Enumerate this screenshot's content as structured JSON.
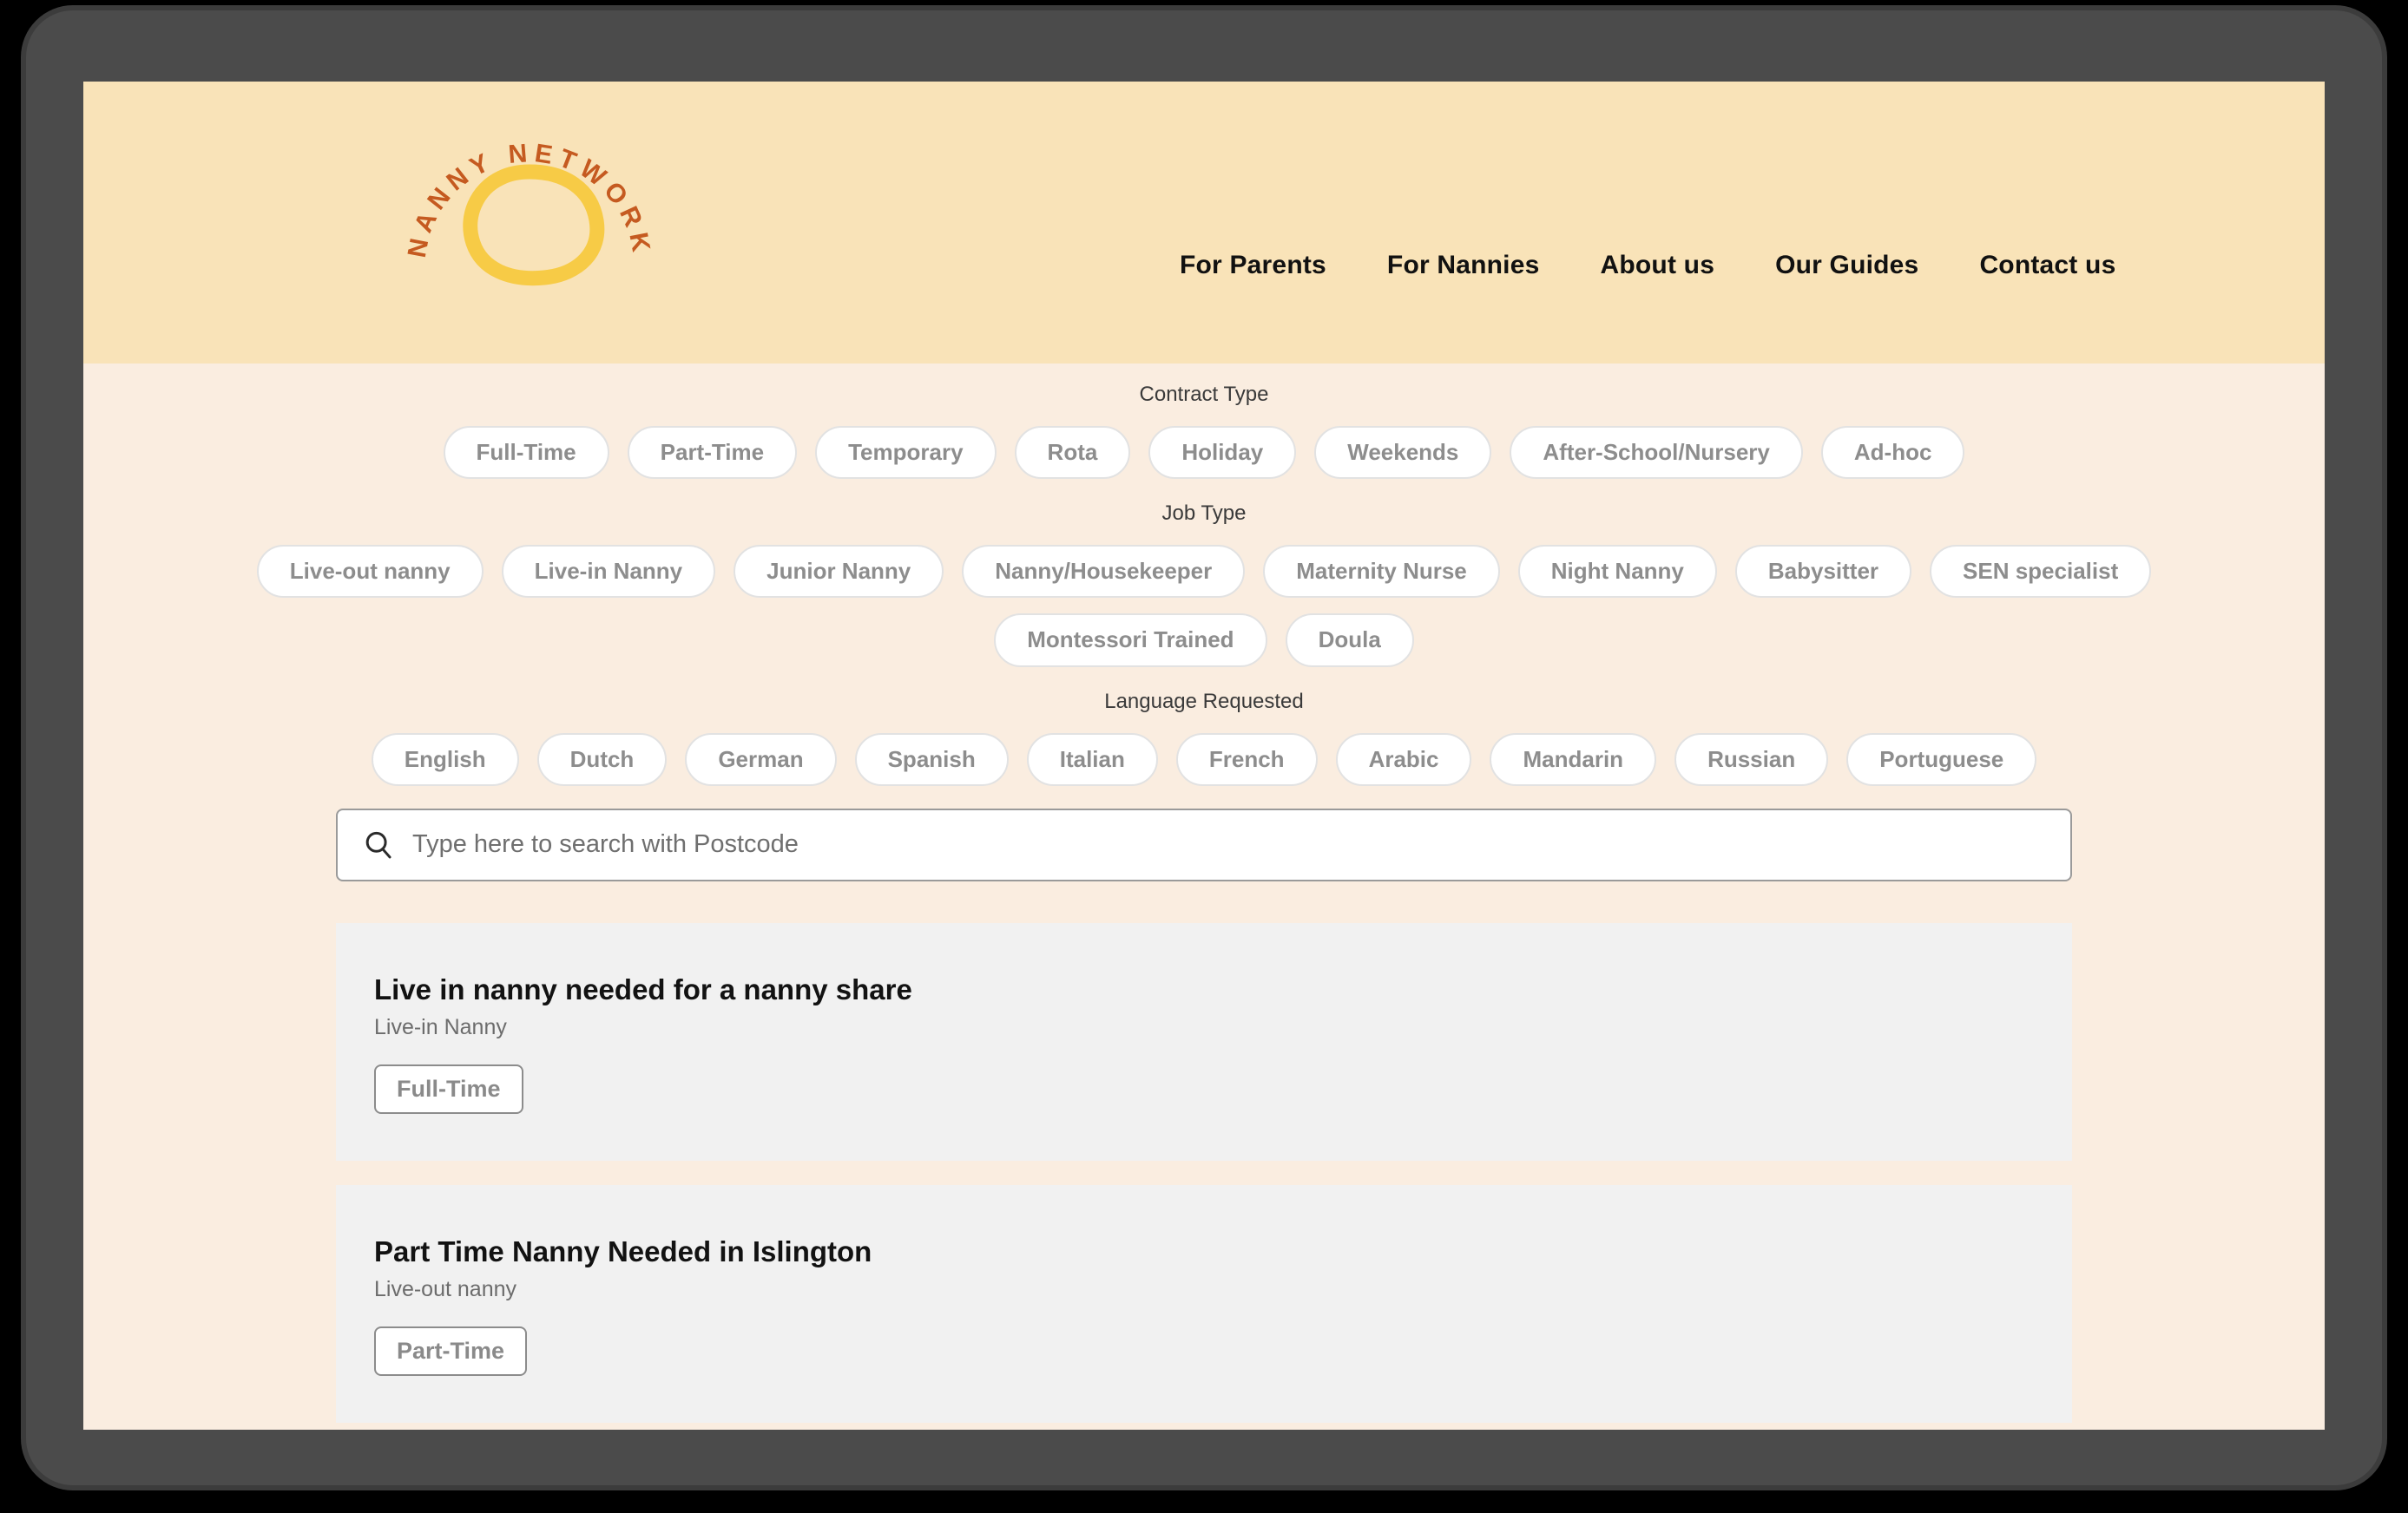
{
  "brand": {
    "name": "NANNY NETWORK",
    "arc_text": "NANNY NETWORK",
    "ring_color": "#f7cb46",
    "text_color": "#c55a20"
  },
  "header": {
    "background_color": "#f9e3b8",
    "nav": [
      {
        "label": "For Parents"
      },
      {
        "label": "For Nannies"
      },
      {
        "label": "About us"
      },
      {
        "label": "Our Guides"
      },
      {
        "label": "Contact us"
      }
    ]
  },
  "page": {
    "background_color": "#faede0"
  },
  "filters": [
    {
      "group": "contract-type",
      "label": "Contract Type",
      "rows": [
        [
          "Full-Time",
          "Part-Time",
          "Temporary",
          "Rota",
          "Holiday",
          "Weekends",
          "After-School/Nursery",
          "Ad-hoc"
        ]
      ]
    },
    {
      "group": "job-type",
      "label": "Job Type",
      "rows": [
        [
          "Live-out nanny",
          "Live-in Nanny",
          "Junior Nanny",
          "Nanny/Housekeeper",
          "Maternity Nurse",
          "Night Nanny",
          "Babysitter",
          "SEN specialist"
        ],
        [
          "Montessori Trained",
          "Doula"
        ]
      ]
    },
    {
      "group": "language-requested",
      "label": "Language Requested",
      "rows": [
        [
          "English",
          "Dutch",
          "German",
          "Spanish",
          "Italian",
          "French",
          "Arabic",
          "Mandarin",
          "Russian",
          "Portuguese"
        ]
      ]
    }
  ],
  "search": {
    "placeholder": "Type here to search with Postcode",
    "value": "",
    "icon": "search-icon"
  },
  "jobs": [
    {
      "title": "Live in nanny needed for a nanny share",
      "job_type": "Live-in Nanny",
      "contract_tag": "Full-Time"
    },
    {
      "title": "Part Time Nanny Needed in Islington",
      "job_type": "Live-out nanny",
      "contract_tag": "Part-Time"
    }
  ]
}
